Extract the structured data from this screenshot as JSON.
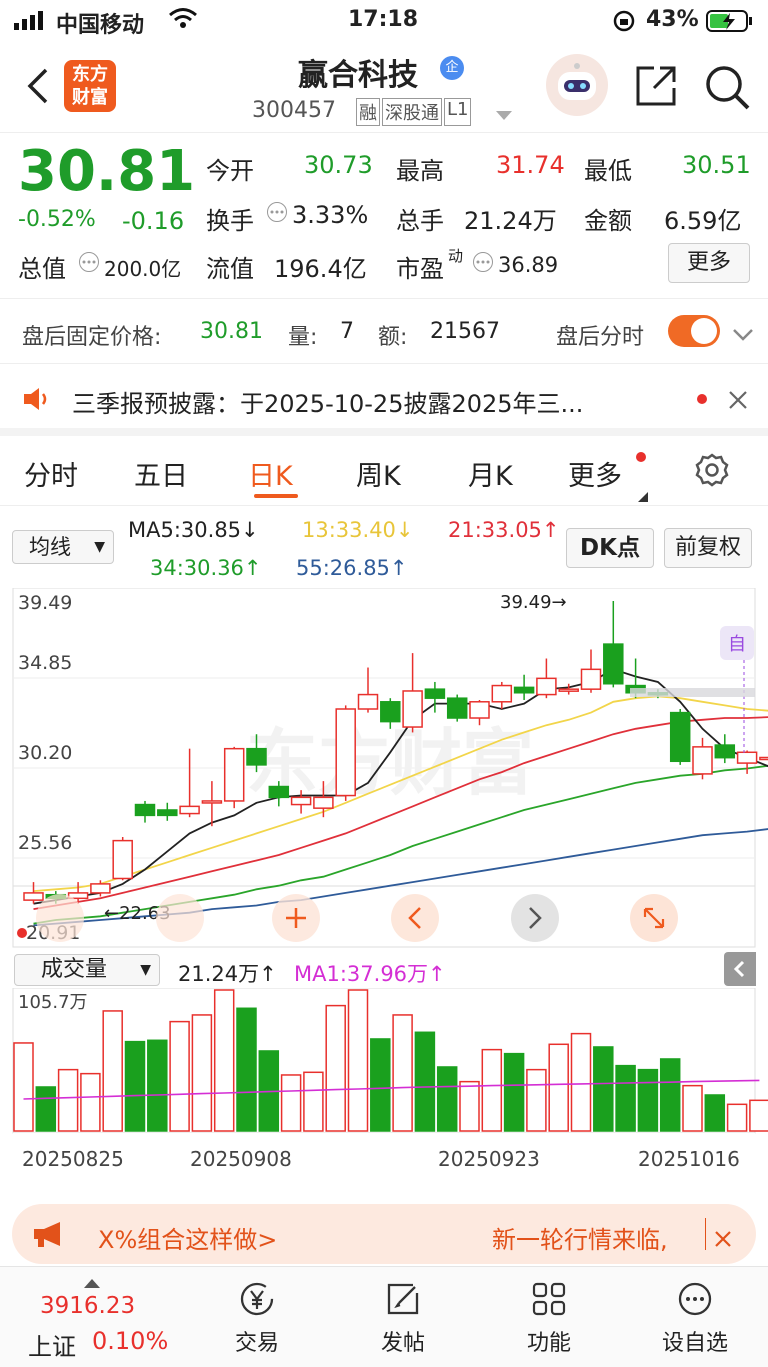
{
  "status": {
    "carrier": "中国移动",
    "time": "17:18",
    "battery": "43%"
  },
  "header": {
    "brand_line1": "东方",
    "brand_line2": "财富",
    "title": "赢合科技",
    "title_badge": "企",
    "code": "300457",
    "tags": [
      "融",
      "深股通",
      "L1"
    ]
  },
  "quote": {
    "price": "30.81",
    "pct": "-0.52%",
    "chg": "-0.16",
    "open_label": "今开",
    "open": "30.73",
    "high_label": "最高",
    "high": "31.74",
    "low_label": "最低",
    "low": "30.51",
    "turnover_label": "换手",
    "turnover": "3.33%",
    "vol_label": "总手",
    "vol": "21.24万",
    "amount_label": "金额",
    "amount": "6.59亿",
    "mktcap_label": "总值",
    "mktcap": "200.0亿",
    "float_label": "流值",
    "float": "196.4亿",
    "pe_label": "市盈",
    "pe_sup": "动",
    "pe": "36.89",
    "more": "更多"
  },
  "after_hours": {
    "label": "盘后固定价格:",
    "price": "30.81",
    "vol_label": "量:",
    "vol": "7",
    "amt_label": "额:",
    "amt": "21567",
    "toggle_label": "盘后分时"
  },
  "notice": {
    "text": "三季报预披露：于2025-10-25披露2025年三..."
  },
  "tabs": [
    "分时",
    "五日",
    "日K",
    "周K",
    "月K",
    "更多"
  ],
  "ma": {
    "selector": "均线",
    "ma5": "MA5:30.85↓",
    "ma13": "13:33.40↓",
    "ma21": "21:33.05↑",
    "ma34": "34:30.36↑",
    "ma55": "55:26.85↑",
    "dk": "DK点",
    "adjust": "前复权"
  },
  "kline": {
    "y_ticks": [
      "39.49",
      "34.85",
      "30.20",
      "25.56"
    ],
    "y_bottom_partial": "20.91",
    "high_marker": "39.49→",
    "low_marker": "←22.63",
    "auto_label": "自",
    "watermark": "东方财富",
    "colors": {
      "up": "#e8302c",
      "down": "#1aa01e",
      "ma5": "#222222",
      "ma13": "#f2d54a",
      "ma21": "#e0303a",
      "ma34": "#2aa52a",
      "ma55": "#2f5b99"
    }
  },
  "volume": {
    "selector": "成交量",
    "value": "21.24万↑",
    "ma1": "MA1:37.96万↑",
    "max_label": "105.7万",
    "dates": [
      "20250825",
      "20250908",
      "20250923",
      "20251016"
    ]
  },
  "ad": {
    "left": "X%组合这样做>",
    "right": "新一轮行情来临,"
  },
  "bottom_nav": {
    "index_value": "3916.23",
    "index_name": "上证",
    "index_pct": "0.10%",
    "items": [
      "交易",
      "发帖",
      "功能",
      "设自选"
    ]
  },
  "chart_data": {
    "type": "candlestick",
    "title": "赢合科技 日K",
    "ylim": [
      20.91,
      39.49
    ],
    "candles": [
      {
        "o": 22.9,
        "c": 23.3,
        "h": 23.9,
        "l": 22.7
      },
      {
        "o": 23.2,
        "c": 23.0,
        "h": 23.4,
        "l": 22.7
      },
      {
        "o": 23.0,
        "c": 23.3,
        "h": 23.9,
        "l": 22.7
      },
      {
        "o": 23.3,
        "c": 23.8,
        "h": 24.0,
        "l": 23.1
      },
      {
        "o": 24.1,
        "c": 26.2,
        "h": 26.4,
        "l": 24.0
      },
      {
        "o": 28.2,
        "c": 27.6,
        "h": 28.4,
        "l": 27.2
      },
      {
        "o": 27.9,
        "c": 27.6,
        "h": 28.3,
        "l": 27.3
      },
      {
        "o": 27.7,
        "c": 28.1,
        "h": 31.3,
        "l": 27.5
      },
      {
        "o": 28.4,
        "c": 28.4,
        "h": 29.5,
        "l": 27.0
      },
      {
        "o": 28.4,
        "c": 31.3,
        "h": 31.4,
        "l": 28.0
      },
      {
        "o": 31.3,
        "c": 30.4,
        "h": 32.1,
        "l": 30.0
      },
      {
        "o": 29.2,
        "c": 28.6,
        "h": 29.5,
        "l": 28.1
      },
      {
        "o": 28.2,
        "c": 28.6,
        "h": 29.0,
        "l": 27.7
      },
      {
        "o": 28.0,
        "c": 28.6,
        "h": 29.5,
        "l": 27.5
      },
      {
        "o": 28.7,
        "c": 33.5,
        "h": 33.7,
        "l": 28.4
      },
      {
        "o": 33.5,
        "c": 34.3,
        "h": 35.8,
        "l": 33.3
      },
      {
        "o": 33.9,
        "c": 32.8,
        "h": 34.1,
        "l": 32.4
      },
      {
        "o": 32.5,
        "c": 34.5,
        "h": 36.6,
        "l": 32.2
      },
      {
        "o": 34.6,
        "c": 34.1,
        "h": 35.0,
        "l": 33.3
      },
      {
        "o": 34.1,
        "c": 33.0,
        "h": 34.3,
        "l": 32.8
      },
      {
        "o": 33.0,
        "c": 33.9,
        "h": 34.0,
        "l": 32.6
      },
      {
        "o": 33.9,
        "c": 34.8,
        "h": 35.0,
        "l": 33.5
      },
      {
        "o": 34.7,
        "c": 34.4,
        "h": 35.4,
        "l": 34.0
      },
      {
        "o": 34.3,
        "c": 35.2,
        "h": 36.3,
        "l": 34.1
      },
      {
        "o": 34.5,
        "c": 34.6,
        "h": 34.9,
        "l": 34.3
      },
      {
        "o": 34.6,
        "c": 35.7,
        "h": 36.8,
        "l": 34.4
      },
      {
        "o": 37.1,
        "c": 34.9,
        "h": 39.49,
        "l": 34.7
      },
      {
        "o": 34.8,
        "c": 34.4,
        "h": 36.3,
        "l": 34.1
      },
      {
        "o": 34.4,
        "c": 34.3,
        "h": 34.6,
        "l": 34.1
      },
      {
        "o": 33.3,
        "c": 30.6,
        "h": 33.5,
        "l": 30.4
      },
      {
        "o": 29.9,
        "c": 31.4,
        "h": 31.9,
        "l": 29.6
      },
      {
        "o": 31.5,
        "c": 30.8,
        "h": 32.1,
        "l": 30.5
      },
      {
        "o": 30.5,
        "c": 31.1,
        "h": 31.2,
        "l": 29.9
      },
      {
        "o": 30.73,
        "c": 30.81,
        "h": 31.0,
        "l": 30.51
      }
    ],
    "ma5": [
      22.7,
      22.9,
      23.1,
      23.3,
      23.8,
      24.6,
      25.6,
      26.6,
      27.2,
      27.6,
      28.3,
      28.6,
      28.7,
      28.7,
      28.7,
      29.4,
      31.1,
      32.9,
      33.8,
      33.8,
      33.8,
      33.5,
      33.8,
      34.6,
      34.7,
      35.0,
      35.7,
      35.3,
      35.0,
      33.9,
      32.4,
      31.3,
      30.8,
      30.3
    ],
    "ma13": [
      23.4,
      23.5,
      23.6,
      23.8,
      24.2,
      24.6,
      25.0,
      25.4,
      25.8,
      26.2,
      26.6,
      27.0,
      27.4,
      27.8,
      28.3,
      28.8,
      29.3,
      29.8,
      30.3,
      30.8,
      31.3,
      31.8,
      32.2,
      32.6,
      32.9,
      33.3,
      33.9,
      34.1,
      34.2,
      34.1,
      33.9,
      33.7,
      33.5,
      33.4
    ],
    "ma21": [
      22.4,
      22.6,
      22.8,
      23.0,
      23.3,
      23.6,
      23.9,
      24.2,
      24.5,
      24.8,
      25.1,
      25.4,
      25.8,
      26.2,
      26.6,
      27.1,
      27.6,
      28.1,
      28.6,
      29.1,
      29.6,
      30.0,
      30.5,
      30.9,
      31.3,
      31.7,
      32.1,
      32.4,
      32.6,
      32.8,
      32.9,
      33.0,
      33.0,
      33.05
    ],
    "ma34": [
      21.6,
      21.8,
      21.9,
      22.0,
      22.2,
      22.4,
      22.6,
      22.8,
      23.0,
      23.2,
      23.5,
      23.7,
      24.0,
      24.2,
      24.6,
      25.0,
      25.4,
      25.9,
      26.3,
      26.7,
      27.1,
      27.5,
      27.9,
      28.2,
      28.5,
      28.8,
      29.1,
      29.4,
      29.6,
      29.8,
      29.9,
      30.1,
      30.2,
      30.36
    ],
    "ma55": [
      21.5,
      21.6,
      21.7,
      21.8,
      21.9,
      22.0,
      22.1,
      22.2,
      22.4,
      22.5,
      22.6,
      22.8,
      22.9,
      23.1,
      23.3,
      23.5,
      23.7,
      23.9,
      24.1,
      24.3,
      24.5,
      24.7,
      24.9,
      25.1,
      25.3,
      25.5,
      25.7,
      25.9,
      26.1,
      26.3,
      26.5,
      26.6,
      26.7,
      26.85
    ],
    "volume_ylim": [
      0,
      105.7
    ],
    "volume": [
      66,
      33,
      46,
      43,
      90,
      67,
      68,
      82,
      87,
      105.7,
      92,
      60,
      42,
      44,
      94,
      105.7,
      69,
      87,
      74,
      48,
      37,
      61,
      58,
      46,
      65,
      73,
      63,
      49,
      46,
      54,
      34,
      27,
      20,
      23
    ],
    "volume_ma1": [
      24,
      24.5,
      25,
      25.5,
      26,
      26.5,
      27,
      27.5,
      28,
      28.5,
      29,
      29.5,
      30,
      30.5,
      31,
      31.5,
      32,
      32.5,
      33,
      33.3,
      33.6,
      34,
      34.3,
      34.6,
      35,
      35.3,
      35.6,
      36,
      36.3,
      36.6,
      37,
      37.3,
      37.6,
      37.96
    ]
  }
}
